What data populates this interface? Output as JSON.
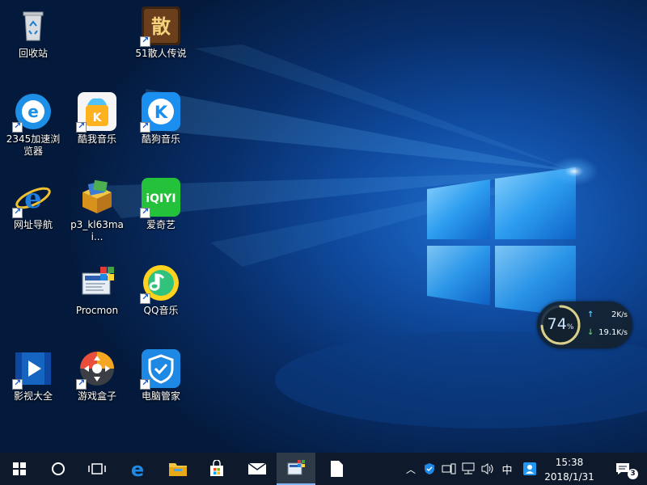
{
  "desktop_icons": [
    {
      "label": "回收站",
      "icon": "recycle-bin-icon"
    },
    {
      "label": "51散人传说",
      "icon": "game-icon"
    },
    {
      "label": "2345加速浏览器",
      "icon": "browser-2345-icon"
    },
    {
      "label": "酷我音乐",
      "icon": "kuwo-music-icon"
    },
    {
      "label": "酷狗音乐",
      "icon": "kugou-music-icon"
    },
    {
      "label": "网址导航",
      "icon": "ie-icon"
    },
    {
      "label": "p3_kl63mai...",
      "icon": "installer-box-icon"
    },
    {
      "label": "爱奇艺",
      "icon": "iqiyi-icon"
    },
    {
      "label": "Procmon",
      "icon": "procmon-icon"
    },
    {
      "label": "QQ音乐",
      "icon": "qq-music-icon"
    },
    {
      "label": "影视大全",
      "icon": "video-player-icon"
    },
    {
      "label": "游戏盒子",
      "icon": "gamepad-icon"
    },
    {
      "label": "电脑管家",
      "icon": "shield-icon"
    }
  ],
  "net_widget": {
    "percent": "74",
    "percent_unit": "%",
    "up_value": "2",
    "up_unit": "K/s",
    "down_value": "19.1",
    "down_unit": "K/s",
    "ring_fraction": 0.74,
    "ring_color": "#d8d08a"
  },
  "taskbar": {
    "ime_label": "中",
    "time": "15:38",
    "date": "2018/1/31",
    "notification_count": "3"
  },
  "colors": {
    "taskbar_bg": "#0e1a2b",
    "accent": "#1e90ff"
  }
}
